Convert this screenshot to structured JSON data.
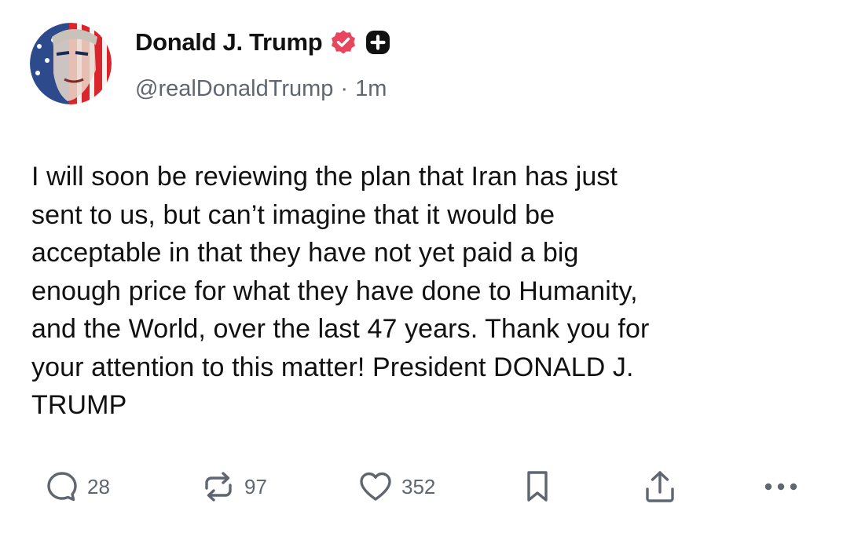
{
  "post": {
    "author": {
      "display_name": "Donald J. Trump",
      "handle": "@realDonaldTrump",
      "verified_icon": "verified-badge-icon",
      "badge_icon": "plus-badge-icon",
      "avatar_alt": "avatar"
    },
    "meta": {
      "separator": "·",
      "timestamp": "1m"
    },
    "text": "I will soon be reviewing the plan that Iran has just\nsent to us, but can’t imagine that it would be\nacceptable in that they have not yet paid a big\nenough price for what they have done to Humanity,\nand the World, over the last 47 years. Thank you for\nyour attention to this matter! President DONALD J.\nTRUMP",
    "actions": {
      "replies": {
        "icon": "reply-icon",
        "count": "28"
      },
      "reposts": {
        "icon": "repost-icon",
        "count": "97"
      },
      "likes": {
        "icon": "heart-icon",
        "count": "352"
      },
      "bookmark": {
        "icon": "bookmark-icon"
      },
      "share": {
        "icon": "share-icon"
      },
      "more": {
        "icon": "more-icon"
      }
    },
    "colors": {
      "text": "#111111",
      "muted": "#5f6670",
      "verified": "#e8455f",
      "badge": "#111111"
    }
  }
}
